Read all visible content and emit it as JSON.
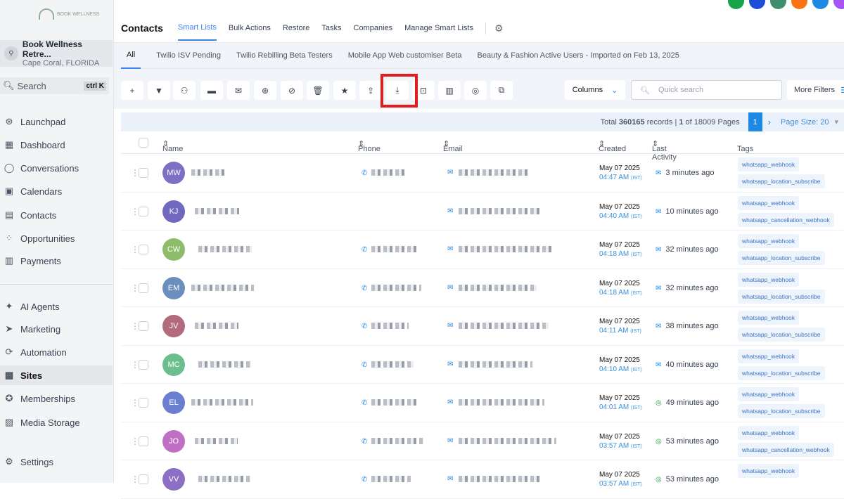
{
  "sidebar": {
    "logo": "BOOK WELLNESS",
    "account_name": "Book Wellness Retre...",
    "account_location": "Cape Coral, FLORIDA",
    "search": "Search",
    "shortcut": "ctrl K",
    "items": [
      {
        "label": "Launchpad",
        "icon": "rocket-icon"
      },
      {
        "label": "Dashboard",
        "icon": "grid-icon"
      },
      {
        "label": "Conversations",
        "icon": "chat-icon"
      },
      {
        "label": "Calendars",
        "icon": "calendar-icon"
      },
      {
        "label": "Contacts",
        "icon": "contacts-icon"
      },
      {
        "label": "Opportunities",
        "icon": "opportunities-icon"
      },
      {
        "label": "Payments",
        "icon": "payments-icon"
      },
      {
        "label": "AI Agents",
        "icon": "sparkle-icon"
      },
      {
        "label": "Marketing",
        "icon": "send-icon"
      },
      {
        "label": "Automation",
        "icon": "automation-icon"
      },
      {
        "label": "Sites",
        "icon": "sites-icon"
      },
      {
        "label": "Memberships",
        "icon": "badge-icon"
      },
      {
        "label": "Media Storage",
        "icon": "image-icon"
      },
      {
        "label": "Settings",
        "icon": "gear-icon"
      }
    ]
  },
  "header": {
    "title": "Contacts",
    "tabs": [
      "Smart Lists",
      "Bulk Actions",
      "Restore",
      "Tasks",
      "Companies",
      "Manage Smart Lists"
    ]
  },
  "smart_lists": [
    "All",
    "Twilio ISV Pending",
    "Twilio Rebilling Beta Testers",
    "Mobile App Web customiser Beta",
    "Beauty & Fashion Active Users - Imported on Feb 13, 2025"
  ],
  "toolbar": {
    "columns": "Columns",
    "quick_search_placeholder": "Quick search",
    "more_filters": "More Filters"
  },
  "pagination": {
    "total_prefix": "Total",
    "total": "360165",
    "records_text": "records |",
    "page": "1",
    "of_text": "of 18009 Pages",
    "current": "1",
    "page_size": "Page Size: 20"
  },
  "table": {
    "headers": [
      "Name",
      "Phone",
      "Email",
      "Created",
      "Last Activity",
      "Tags"
    ],
    "rows": [
      {
        "initials": "MW",
        "color": "#7c6fc4",
        "date": "May 07 2025",
        "time": "04:47 AM",
        "tz": "(IST)",
        "activity": "3 minutes ago",
        "wa": false,
        "phone": true,
        "tags": [
          "whatsapp_webhook",
          "whatsapp_location_subscribe"
        ]
      },
      {
        "initials": "KJ",
        "color": "#7069bf",
        "date": "May 07 2025",
        "time": "04:40 AM",
        "tz": "(IST)",
        "activity": "10 minutes ago",
        "wa": false,
        "phone": false,
        "tags": [
          "whatsapp_webhook",
          "whatsapp_cancellation_webhook"
        ]
      },
      {
        "initials": "CW",
        "color": "#8dbd6a",
        "date": "May 07 2025",
        "time": "04:18 AM",
        "tz": "(IST)",
        "activity": "32 minutes ago",
        "wa": false,
        "phone": true,
        "tags": [
          "whatsapp_webhook",
          "whatsapp_location_subscribe"
        ]
      },
      {
        "initials": "EM",
        "color": "#6b8fbd",
        "date": "May 07 2025",
        "time": "04:18 AM",
        "tz": "(IST)",
        "activity": "32 minutes ago",
        "wa": false,
        "phone": true,
        "tags": [
          "whatsapp_webhook",
          "whatsapp_location_subscribe"
        ]
      },
      {
        "initials": "JV",
        "color": "#b36a7c",
        "date": "May 07 2025",
        "time": "04:11 AM",
        "tz": "(IST)",
        "activity": "38 minutes ago",
        "wa": false,
        "phone": true,
        "tags": [
          "whatsapp_webhook",
          "whatsapp_location_subscribe"
        ]
      },
      {
        "initials": "MC",
        "color": "#6bbf8c",
        "date": "May 07 2025",
        "time": "04:10 AM",
        "tz": "(IST)",
        "activity": "40 minutes ago",
        "wa": false,
        "phone": true,
        "tags": [
          "whatsapp_webhook",
          "whatsapp_location_subscribe"
        ]
      },
      {
        "initials": "EL",
        "color": "#6a7fd0",
        "date": "May 07 2025",
        "time": "04:01 AM",
        "tz": "(IST)",
        "activity": "49 minutes ago",
        "wa": true,
        "phone": true,
        "tags": [
          "whatsapp_webhook",
          "whatsapp_location_subscribe"
        ]
      },
      {
        "initials": "JO",
        "color": "#c070c4",
        "date": "May 07 2025",
        "time": "03:57 AM",
        "tz": "(IST)",
        "activity": "53 minutes ago",
        "wa": true,
        "phone": true,
        "tags": [
          "whatsapp_webhook",
          "whatsapp_cancellation_webhook"
        ]
      },
      {
        "initials": "VV",
        "color": "#8a6fc4",
        "date": "May 07 2025",
        "time": "03:57 AM",
        "tz": "(IST)",
        "activity": "53 minutes ago",
        "wa": true,
        "phone": true,
        "tags": [
          "whatsapp_webhook"
        ]
      }
    ]
  },
  "colors": {
    "accent": "#1e88e5",
    "highlight": "#e11d1d"
  }
}
